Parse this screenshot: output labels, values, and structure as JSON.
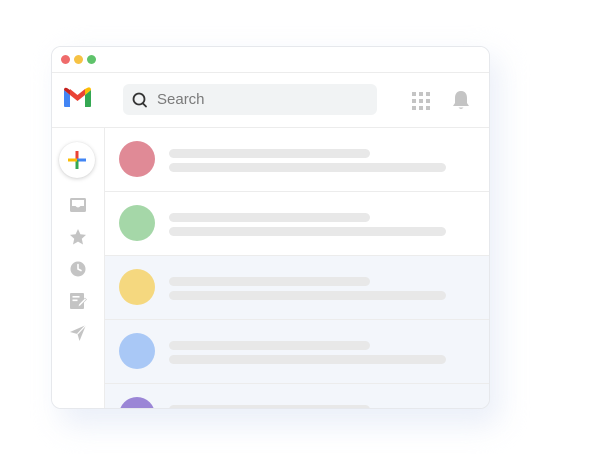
{
  "window": {
    "traffic_lights": [
      "#ef6b6b",
      "#f6c244",
      "#5fc36b"
    ]
  },
  "header": {
    "logo_icon": "gmail-logo",
    "search": {
      "placeholder": "Search",
      "icon": "search-icon"
    },
    "apps_icon": "apps-grid-icon",
    "notifications_icon": "bell-icon"
  },
  "sidebar": {
    "compose_icon": "plus-icon",
    "items": [
      {
        "name": "inbox",
        "icon": "inbox-icon"
      },
      {
        "name": "starred",
        "icon": "star-icon"
      },
      {
        "name": "snoozed",
        "icon": "clock-icon"
      },
      {
        "name": "drafts",
        "icon": "draft-icon"
      },
      {
        "name": "sent",
        "icon": "send-icon"
      }
    ]
  },
  "email_list": {
    "rows": [
      {
        "avatar_color": "#e08a96",
        "background": "#ffffff"
      },
      {
        "avatar_color": "#a5d7a8",
        "background": "#ffffff"
      },
      {
        "avatar_color": "#f5d87f",
        "background": "#f3f6fb"
      },
      {
        "avatar_color": "#a9c8f6",
        "background": "#f3f6fb"
      },
      {
        "avatar_color": "#9b86d6",
        "background": "#f3f6fb"
      }
    ]
  }
}
